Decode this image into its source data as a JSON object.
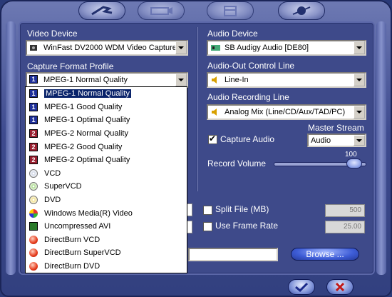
{
  "colors": {
    "panel": "#3e4a8a",
    "highlight": "#0a246a"
  },
  "video": {
    "device_label": "Video Device",
    "device_value": "WinFast DV2000 WDM Video Capture.",
    "profile_label": "Capture Format Profile",
    "profile_value": "MPEG-1 Normal Quality",
    "profile_options": [
      {
        "label": "MPEG-1 Normal Quality",
        "icon": "mpeg1-icon",
        "selected": true
      },
      {
        "label": "MPEG-1 Good Quality",
        "icon": "mpeg1-icon"
      },
      {
        "label": "MPEG-1 Optimal Quality",
        "icon": "mpeg1-icon"
      },
      {
        "label": "MPEG-2 Normal Quality",
        "icon": "mpeg2-icon"
      },
      {
        "label": "MPEG-2 Good Quality",
        "icon": "mpeg2-icon"
      },
      {
        "label": "MPEG-2 Optimal Quality",
        "icon": "mpeg2-icon"
      },
      {
        "label": "VCD",
        "icon": "cd-icon"
      },
      {
        "label": "SuperVCD",
        "icon": "svcd-icon"
      },
      {
        "label": "DVD",
        "icon": "dvd-icon"
      },
      {
        "label": "Windows Media(R) Video",
        "icon": "wmv-icon"
      },
      {
        "label": "Uncompressed AVI",
        "icon": "avi-icon"
      },
      {
        "label": "DirectBurn VCD",
        "icon": "burn-icon"
      },
      {
        "label": "DirectBurn SuperVCD",
        "icon": "burn-icon"
      },
      {
        "label": "DirectBurn DVD",
        "icon": "burn-icon"
      }
    ]
  },
  "audio": {
    "device_label": "Audio Device",
    "device_value": "SB Audigy Audio [DE80]",
    "out_line_label": "Audio-Out Control Line",
    "out_line_value": "Line-In",
    "rec_line_label": "Audio Recording Line",
    "rec_line_value": "Analog Mix (Line/CD/Aux/TAD/PC)",
    "capture_label": "Capture Audio",
    "capture_checked": true,
    "master_label": "Master Stream",
    "master_value": "Audio",
    "volume_label": "Record Volume",
    "volume_value": "100"
  },
  "options": {
    "split_label": "Split File (MB)",
    "split_value": "500",
    "framerate_label": "Use Frame Rate",
    "framerate_value": "25.00",
    "browse_label": "Browse ..."
  }
}
